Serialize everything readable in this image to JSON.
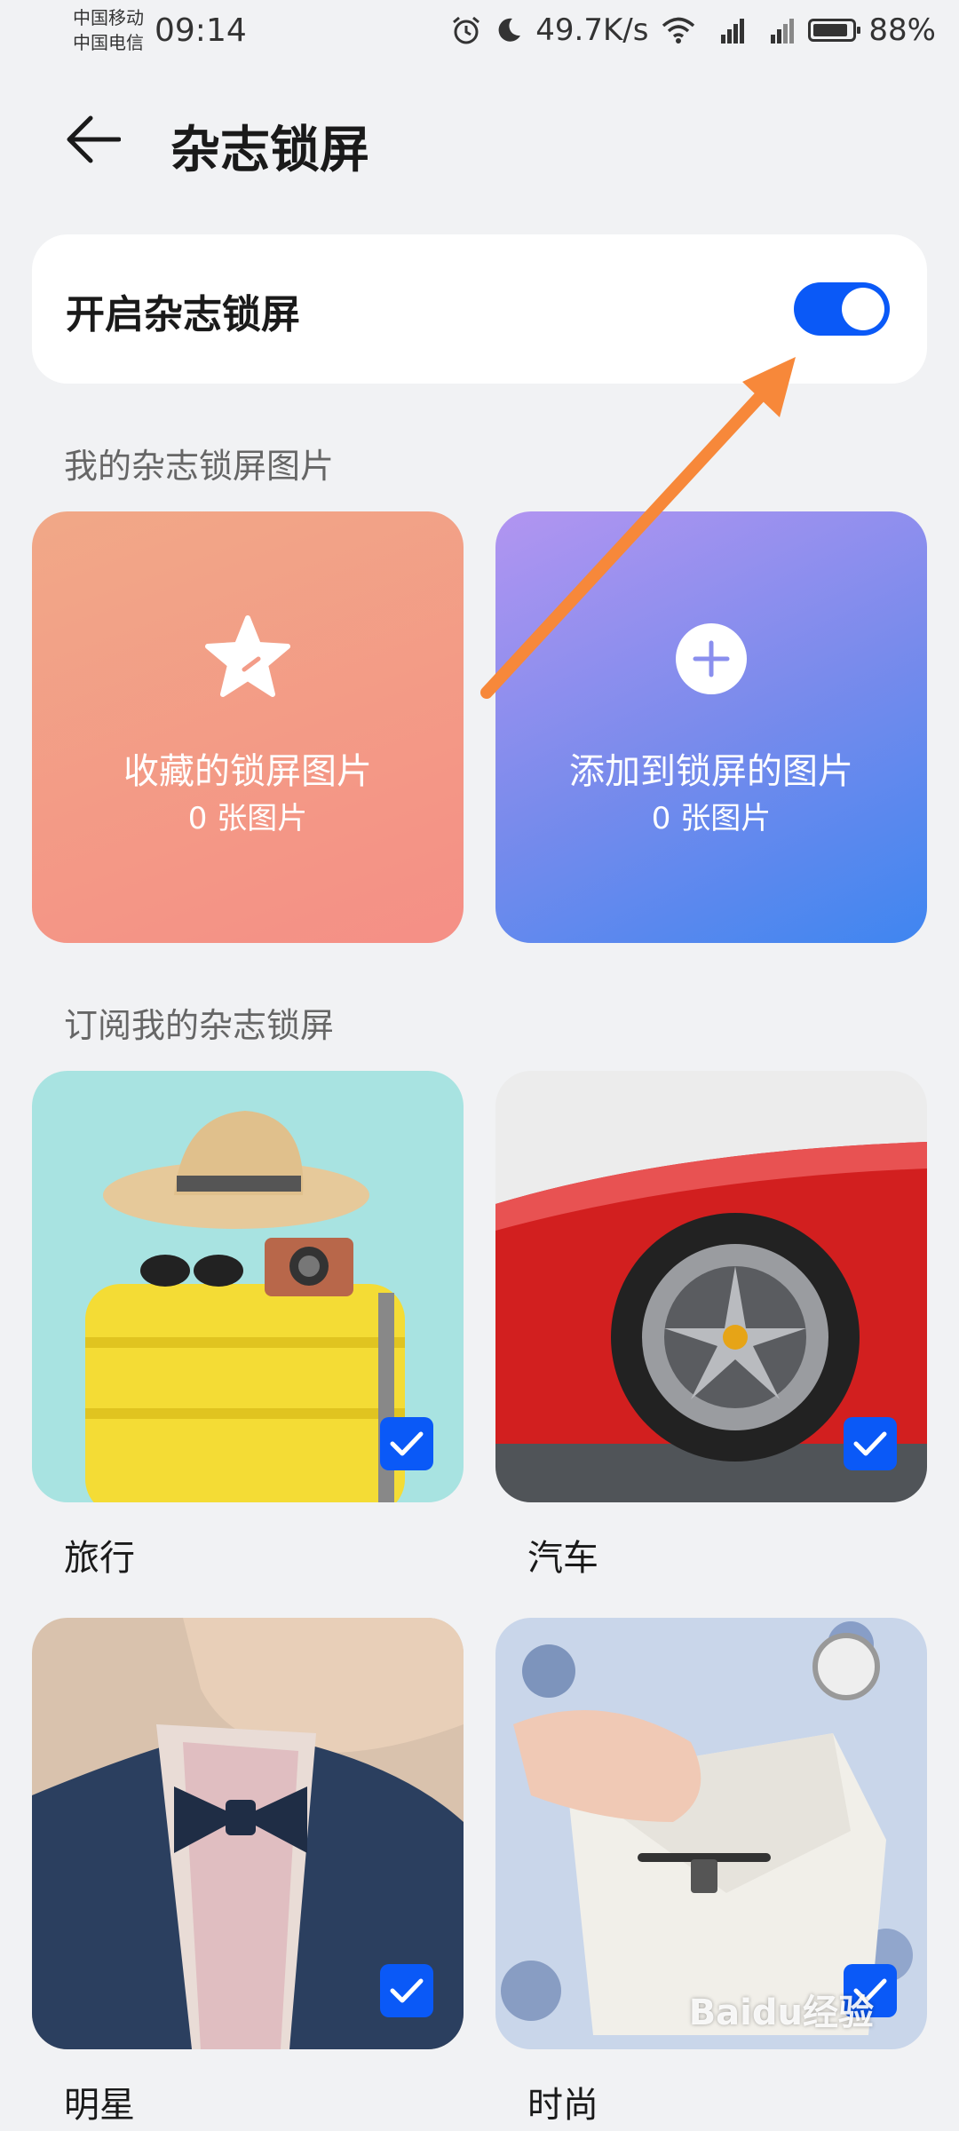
{
  "status_bar": {
    "carrier_1": "中国移动",
    "carrier_2": "中国电信",
    "time": "09:14",
    "net_speed": "49.7K/s",
    "battery": "88%"
  },
  "header": {
    "title": "杂志锁屏"
  },
  "toggle": {
    "label": "开启杂志锁屏",
    "on": true
  },
  "my_pictures": {
    "section_title": "我的杂志锁屏图片",
    "favorites": {
      "title": "收藏的锁屏图片",
      "count": "0 张图片"
    },
    "added": {
      "title": "添加到锁屏的图片",
      "count": "0 张图片"
    }
  },
  "subscriptions": {
    "section_title": "订阅我的杂志锁屏",
    "items": [
      {
        "label": "旅行",
        "checked": true
      },
      {
        "label": "汽车",
        "checked": true
      },
      {
        "label": "明星",
        "checked": true
      },
      {
        "label": "时尚",
        "checked": true
      }
    ]
  },
  "watermark": "Baidu经验",
  "colors": {
    "accent": "#0a59f7",
    "annotation_arrow": "#f7883a"
  }
}
